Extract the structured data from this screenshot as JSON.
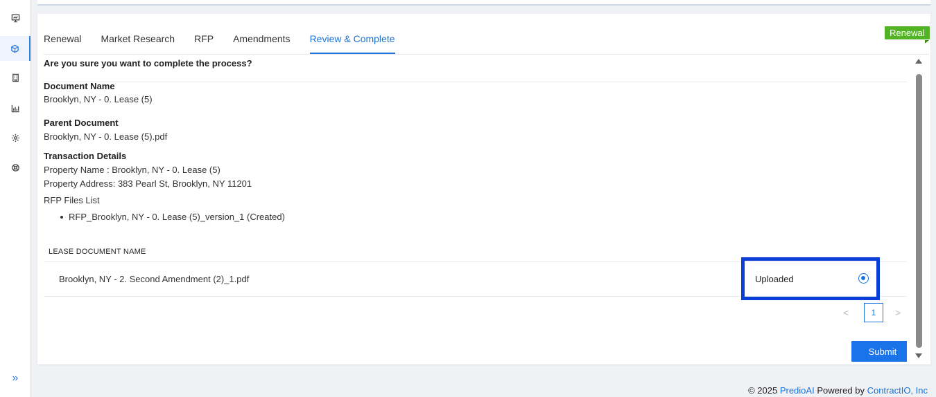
{
  "sidebar": {
    "items": [
      {
        "icon": "presentation-icon",
        "active": false
      },
      {
        "icon": "cube-icon",
        "active": true
      },
      {
        "icon": "building-icon",
        "active": false
      },
      {
        "icon": "bar-chart-icon",
        "active": false
      },
      {
        "icon": "gear-icon",
        "active": false
      },
      {
        "icon": "lifebuoy-icon",
        "active": false
      }
    ],
    "expand_icon": "»"
  },
  "tabs": [
    {
      "label": "Renewal"
    },
    {
      "label": "Market Research"
    },
    {
      "label": "RFP"
    },
    {
      "label": "Amendments"
    },
    {
      "label": "Review & Complete",
      "active": true
    }
  ],
  "ribbon": {
    "label": "Renewal",
    "color": "#52b424"
  },
  "confirm_text": "Are you sure you want to complete the process?",
  "document": {
    "name_label": "Document Name",
    "name_value": "Brooklyn, NY - 0. Lease (5)",
    "parent_label": "Parent Document",
    "parent_value": "Brooklyn, NY - 0. Lease (5).pdf",
    "transaction_label": "Transaction Details",
    "property_name": "Property Name : Brooklyn, NY - 0. Lease (5)",
    "property_address": "Property Address: 383 Pearl St, Brooklyn, NY 11201"
  },
  "rfp_files": {
    "label": "RFP Files List",
    "items": [
      "RFP_Brooklyn, NY - 0. Lease (5)_version_1   (Created)"
    ]
  },
  "lease_table": {
    "header": "LEASE DOCUMENT NAME",
    "rows": [
      {
        "name": "Brooklyn, NY - 2. Second Amendment (2)_1.pdf",
        "status": "Uploaded",
        "selected": true
      }
    ]
  },
  "pagination": {
    "prev": "<",
    "page": "1",
    "next": ">"
  },
  "submit_label": "Submit",
  "footer": {
    "copyright": "© 2025 ",
    "brand": "PredioAI",
    "powered": " Powered by ",
    "company": "ContractIO, Inc"
  },
  "colors": {
    "accent": "#1a73d9",
    "highlight_border": "#0a3ed8",
    "ribbon": "#52b424"
  }
}
